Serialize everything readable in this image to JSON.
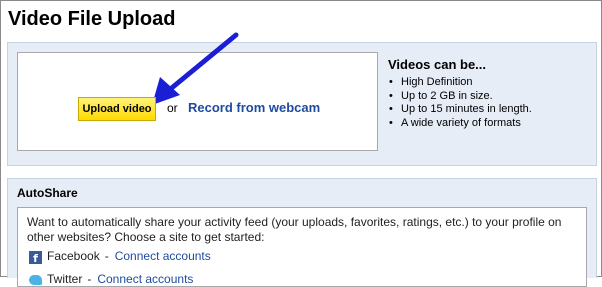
{
  "page": {
    "title": "Video File Upload"
  },
  "upload": {
    "upload_button_label": "Upload video",
    "or_text": "or",
    "record_link_label": "Record from webcam"
  },
  "info": {
    "heading": "Videos can be...",
    "bullets": [
      "High Definition",
      "Up to 2 GB in size.",
      "Up to 15 minutes in length.",
      "A wide variety of formats"
    ]
  },
  "autoshare": {
    "title": "AutoShare",
    "description": "Want to automatically share your activity feed (your uploads, favorites, ratings, etc.) to your profile on other websites? Choose a site to get started:",
    "sites": [
      {
        "name": "Facebook",
        "separator": "-",
        "action": "Connect accounts",
        "icon": "facebook-icon"
      },
      {
        "name": "Twitter",
        "separator": "-",
        "action": "Connect accounts",
        "icon": "twitter-icon"
      }
    ]
  },
  "colors": {
    "panel_bg": "#e7edf6",
    "link": "#1f4b9e",
    "button_yellow": "#ffd900",
    "arrow_blue": "#1a1fd6"
  }
}
